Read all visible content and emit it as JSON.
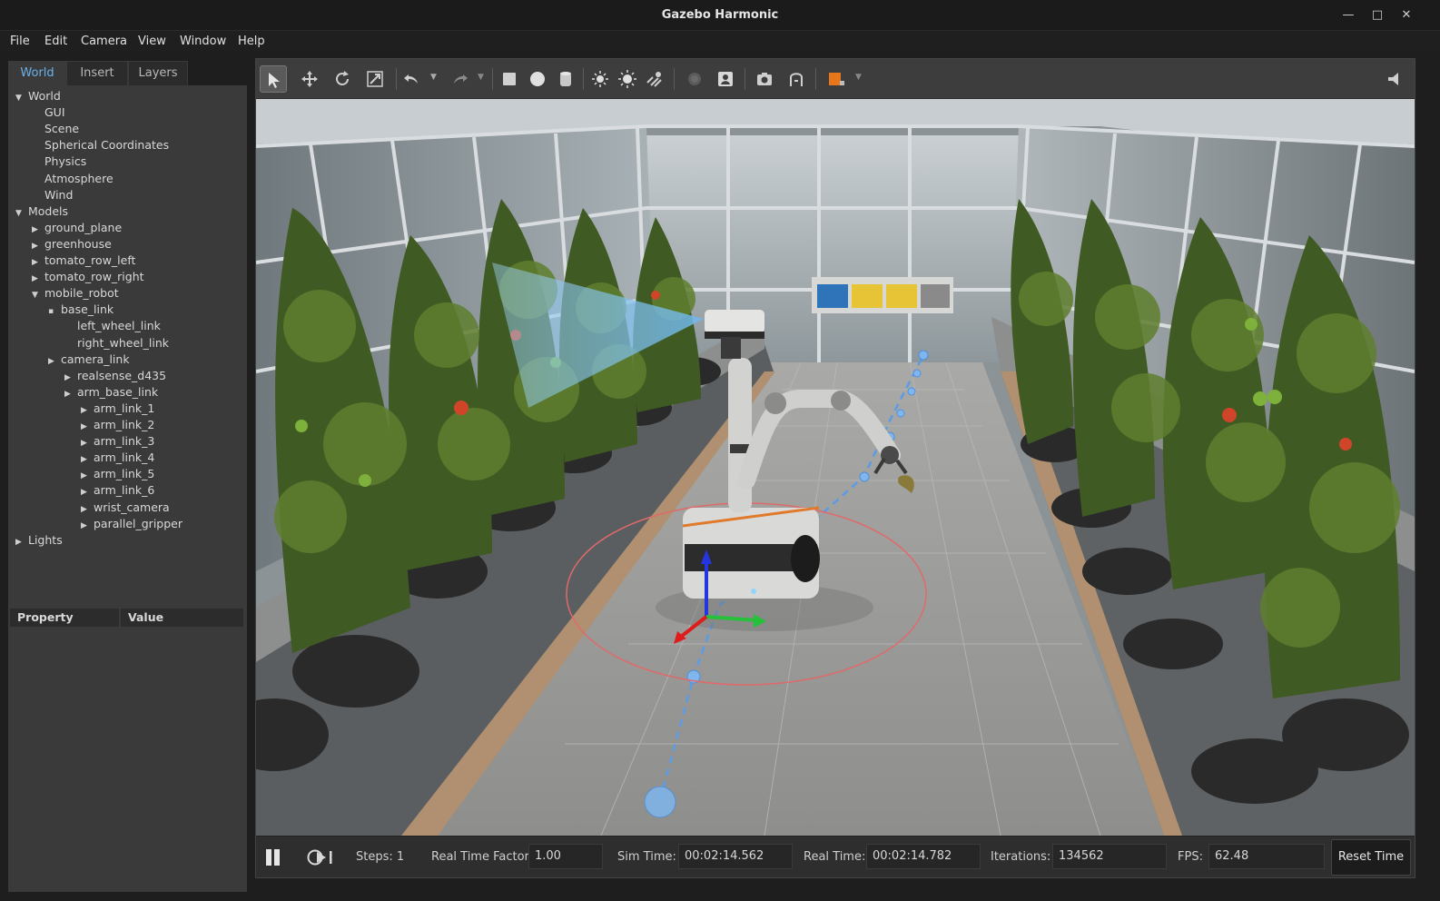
{
  "window": {
    "title": "Gazebo Harmonic"
  },
  "menu": [
    "File",
    "Edit",
    "Camera",
    "View",
    "Window",
    "Help"
  ],
  "tabs": [
    {
      "label": "World",
      "active": true
    },
    {
      "label": "Insert",
      "active": false
    },
    {
      "label": "Layers",
      "active": false
    }
  ],
  "tree": [
    {
      "label": "World",
      "indent": 0,
      "arrow": "down"
    },
    {
      "label": "GUI",
      "indent": 1,
      "arrow": "none"
    },
    {
      "label": "Scene",
      "indent": 1,
      "arrow": "none"
    },
    {
      "label": "Spherical Coordinates",
      "indent": 1,
      "arrow": "none"
    },
    {
      "label": "Physics",
      "indent": 1,
      "arrow": "none"
    },
    {
      "label": "Atmosphere",
      "indent": 1,
      "arrow": "none"
    },
    {
      "label": "Wind",
      "indent": 1,
      "arrow": "none"
    },
    {
      "label": "Models",
      "indent": 0,
      "arrow": "down"
    },
    {
      "label": "ground_plane",
      "indent": 1,
      "arrow": "right"
    },
    {
      "label": "greenhouse",
      "indent": 1,
      "arrow": "right"
    },
    {
      "label": "tomato_row_left",
      "indent": 1,
      "arrow": "right"
    },
    {
      "label": "tomato_row_right",
      "indent": 1,
      "arrow": "right"
    },
    {
      "label": "mobile_robot",
      "indent": 1,
      "arrow": "down"
    },
    {
      "label": "base_link",
      "indent": 2,
      "arrow": "dot"
    },
    {
      "label": "left_wheel_link",
      "indent": 3,
      "arrow": "none"
    },
    {
      "label": "right_wheel_link",
      "indent": 3,
      "arrow": "none"
    },
    {
      "label": "camera_link",
      "indent": 2,
      "arrow": "right"
    },
    {
      "label": "realsense_d435",
      "indent": 3,
      "arrow": "right"
    },
    {
      "label": "arm_base_link",
      "indent": 3,
      "arrow": "right"
    },
    {
      "label": "arm_link_1",
      "indent": 4,
      "arrow": "right"
    },
    {
      "label": "arm_link_2",
      "indent": 4,
      "arrow": "right"
    },
    {
      "label": "arm_link_3",
      "indent": 4,
      "arrow": "right"
    },
    {
      "label": "arm_link_4",
      "indent": 4,
      "arrow": "right"
    },
    {
      "label": "arm_link_5",
      "indent": 4,
      "arrow": "right"
    },
    {
      "label": "arm_link_6",
      "indent": 4,
      "arrow": "right"
    },
    {
      "label": "wrist_camera",
      "indent": 4,
      "arrow": "right"
    },
    {
      "label": "parallel_gripper",
      "indent": 4,
      "arrow": "right"
    },
    {
      "label": "Lights",
      "indent": 0,
      "arrow": "right"
    }
  ],
  "properties": {
    "col_property": "Property",
    "col_value": "Value"
  },
  "toolbar": {
    "icons": [
      "select-icon",
      "translate-icon",
      "rotate-icon",
      "scale-icon",
      "undo-icon",
      "redo-icon",
      "box-shape-icon",
      "sphere-shape-icon",
      "cylinder-shape-icon",
      "point-light-icon",
      "directional-light-icon",
      "spot-light-icon",
      "model-icon",
      "mesh-icon",
      "screenshot-icon",
      "align-icon",
      "color-swatch-icon",
      "collapse-icon"
    ],
    "accent": "#e8761a"
  },
  "status": {
    "steps_label": "Steps: 1",
    "rtf_label": "Real Time Factor:",
    "rtf_value": "1.00",
    "sim_label": "Sim Time:",
    "sim_value": "00:02:14.562",
    "real_label": "Real Time:",
    "real_value": "00:02:14.782",
    "iter_label": "Iterations:",
    "iter_value": "134562",
    "fps_label": "FPS:",
    "fps_value": "62.48",
    "reset_label": "Reset Time"
  }
}
